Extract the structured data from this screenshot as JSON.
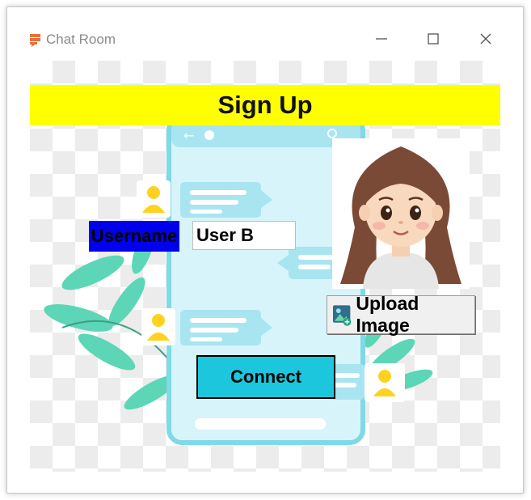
{
  "window": {
    "title": "Chat Room",
    "icon": "chat-bubbles-icon",
    "controls": [
      "minimize-icon",
      "maximize-icon",
      "close-icon"
    ]
  },
  "signup": {
    "banner_title": "Sign Up",
    "username_label": "Username",
    "username_value": "User B",
    "upload_label": "Upload Image",
    "connect_label": "Connect"
  },
  "colors": {
    "banner": "#ffff00",
    "username_label_bg": "#0000ee",
    "connect_bg": "#1cc6dc",
    "phone_screen": "#d8f4fb",
    "phone_frame": "#7fd9e6",
    "leaf": "#5cd6b6",
    "user_icon": "#ffd21f"
  }
}
